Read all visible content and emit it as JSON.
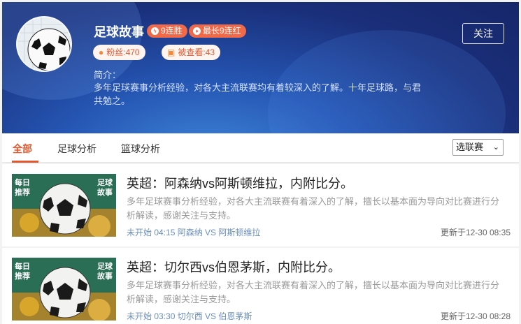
{
  "profile": {
    "name": "足球故事",
    "badge_streak": "9连胜",
    "badge_longest": "最长9连红",
    "followers": "粉丝:470",
    "viewed": "被查看:43",
    "follow_label": "关注",
    "intro_label": "简介：",
    "intro_text": "多年足球赛事分析经验，对各大主流联赛均有着较深入的了解。十年足球路，与君共勉之。"
  },
  "tabs": [
    {
      "label": "全部",
      "active": true
    },
    {
      "label": "足球分析",
      "active": false
    },
    {
      "label": "篮球分析",
      "active": false
    }
  ],
  "league_select": {
    "value": "选联赛"
  },
  "thumb_text": {
    "left": "每日推荐",
    "right": "足球故事"
  },
  "articles": [
    {
      "title": "英超：阿森纳vs阿斯顿维拉，内附比分。",
      "desc": "多年足球赛事分析经验，对各大主流联赛有着深入的了解，擅长以基本面为导向对比赛进行分析解读，感谢关注与支持。",
      "meta": "未开始 04:15 阿森纳 VS 阿斯顿维拉",
      "updated": "更新于12-30 08:35"
    },
    {
      "title": "英超：切尔西vs伯恩茅斯，内附比分。",
      "desc": "多年足球赛事分析经验，对各大主流联赛有着深入的了解，擅长以基本面为导向对比赛进行分析解读，感谢关注与支持。",
      "meta": "未开始 03:30 切尔西 VS 伯恩茅斯",
      "updated": "更新于12-30 08:28"
    }
  ],
  "colors": {
    "accent": "#e4572e",
    "banner": "#1a2f7a",
    "link": "#6b8fbf"
  }
}
